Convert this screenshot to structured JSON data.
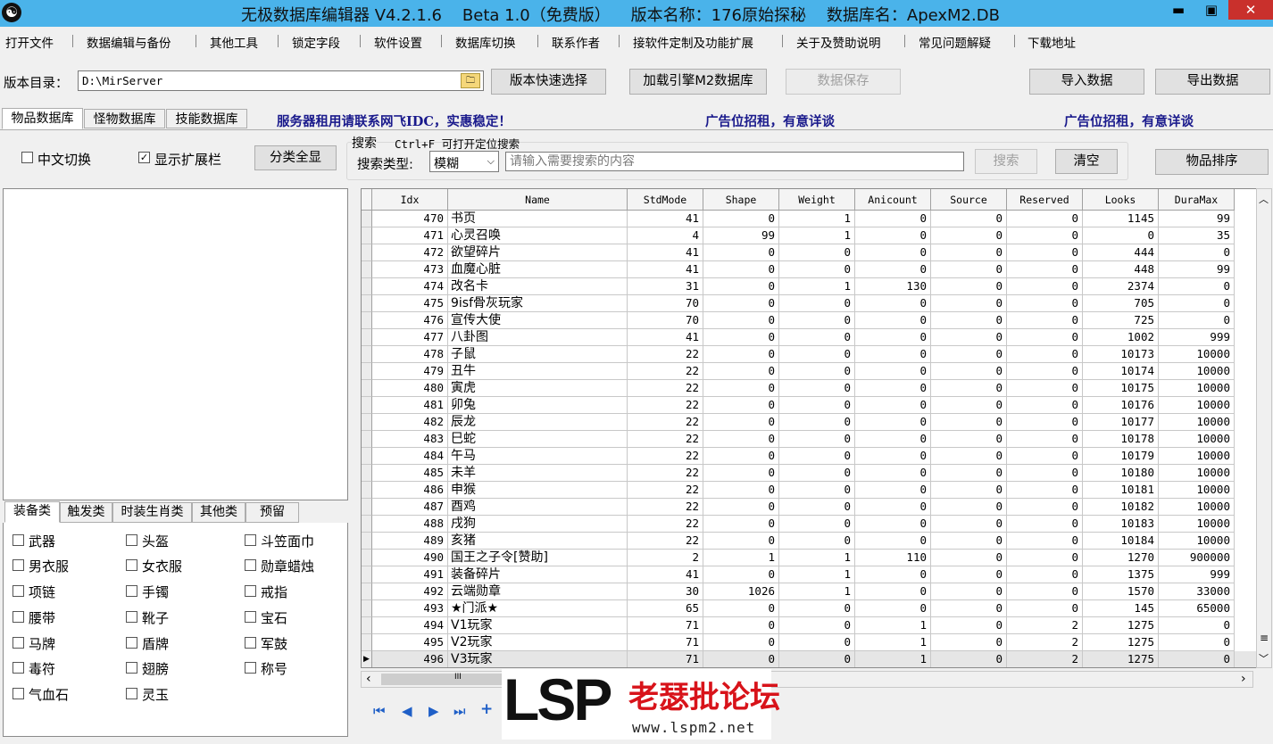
{
  "titlebar": {
    "title": "无极数据库编辑器 V4.2.1.6    Beta 1.0（免费版）    版本名称：176原始探秘    数据库名：ApexM2.DB",
    "app_icon": "yin-yang-icon",
    "min": "▬",
    "max": "▣",
    "close": "✕"
  },
  "menu": [
    "打开文件",
    "数据编辑与备份",
    "其他工具",
    "锁定字段",
    "软件设置",
    "数据库切换",
    "联系作者",
    "接软件定制及功能扩展",
    "关于及赞助说明",
    "常见问题解疑",
    "下载地址"
  ],
  "toolbar": {
    "dir_label": "版本目录：",
    "dir_value": "D:\\MirServer",
    "quick_select": "版本快速选择",
    "load_engine": "加载引擎M2数据库",
    "save": "数据保存",
    "import": "导入数据",
    "export": "导出数据"
  },
  "tabs": [
    "物品数据库",
    "怪物数据库",
    "技能数据库"
  ],
  "ads": [
    "服务器租用请联系网飞IDC，实惠稳定！",
    "广告位招租，有意详谈",
    "广告位招租，有意详谈"
  ],
  "options": {
    "chinese_switch": "中文切换",
    "show_ext": "显示扩展栏",
    "show_all": "分类全显",
    "check": "✓"
  },
  "search": {
    "title": "搜索",
    "hint": "Ctrl+F 可打开定位搜索",
    "type_label": "搜索类型:",
    "type_value": "模糊",
    "placeholder": "请输入需要搜索的内容",
    "search_btn": "搜索",
    "clear_btn": "清空",
    "sort_btn": "物品排序"
  },
  "cat_tabs": [
    "装备类",
    "触发类",
    "时装生肖类",
    "其他类",
    "预留"
  ],
  "categories": [
    "武器",
    "头盔",
    "斗笠面巾",
    "男衣服",
    "女衣服",
    "勋章蜡烛",
    "项链",
    "手镯",
    "戒指",
    "腰带",
    "靴子",
    "宝石",
    "马牌",
    "盾牌",
    "军鼓",
    "毒符",
    "翅膀",
    "称号",
    "气血石",
    "灵玉"
  ],
  "grid": {
    "columns": [
      "Idx",
      "Name",
      "StdMode",
      "Shape",
      "Weight",
      "Anicount",
      "Source",
      "Reserved",
      "Looks",
      "DuraMax"
    ],
    "current_marker": "▶",
    "rows": [
      [
        "470",
        "书页",
        "41",
        "0",
        "1",
        "0",
        "0",
        "0",
        "1145",
        "99"
      ],
      [
        "471",
        "心灵召唤",
        "4",
        "99",
        "1",
        "0",
        "0",
        "0",
        "0",
        "35"
      ],
      [
        "472",
        "欲望碎片",
        "41",
        "0",
        "0",
        "0",
        "0",
        "0",
        "444",
        "0"
      ],
      [
        "473",
        "血魔心脏",
        "41",
        "0",
        "0",
        "0",
        "0",
        "0",
        "448",
        "99"
      ],
      [
        "474",
        "改名卡",
        "31",
        "0",
        "1",
        "130",
        "0",
        "0",
        "2374",
        "0"
      ],
      [
        "475",
        "9isf骨灰玩家",
        "70",
        "0",
        "0",
        "0",
        "0",
        "0",
        "705",
        "0"
      ],
      [
        "476",
        "宣传大使",
        "70",
        "0",
        "0",
        "0",
        "0",
        "0",
        "725",
        "0"
      ],
      [
        "477",
        "八卦图",
        "41",
        "0",
        "0",
        "0",
        "0",
        "0",
        "1002",
        "999"
      ],
      [
        "478",
        "子鼠",
        "22",
        "0",
        "0",
        "0",
        "0",
        "0",
        "10173",
        "10000"
      ],
      [
        "479",
        "丑牛",
        "22",
        "0",
        "0",
        "0",
        "0",
        "0",
        "10174",
        "10000"
      ],
      [
        "480",
        "寅虎",
        "22",
        "0",
        "0",
        "0",
        "0",
        "0",
        "10175",
        "10000"
      ],
      [
        "481",
        "卯兔",
        "22",
        "0",
        "0",
        "0",
        "0",
        "0",
        "10176",
        "10000"
      ],
      [
        "482",
        "辰龙",
        "22",
        "0",
        "0",
        "0",
        "0",
        "0",
        "10177",
        "10000"
      ],
      [
        "483",
        "巳蛇",
        "22",
        "0",
        "0",
        "0",
        "0",
        "0",
        "10178",
        "10000"
      ],
      [
        "484",
        "午马",
        "22",
        "0",
        "0",
        "0",
        "0",
        "0",
        "10179",
        "10000"
      ],
      [
        "485",
        "未羊",
        "22",
        "0",
        "0",
        "0",
        "0",
        "0",
        "10180",
        "10000"
      ],
      [
        "486",
        "申猴",
        "22",
        "0",
        "0",
        "0",
        "0",
        "0",
        "10181",
        "10000"
      ],
      [
        "487",
        "酉鸡",
        "22",
        "0",
        "0",
        "0",
        "0",
        "0",
        "10182",
        "10000"
      ],
      [
        "488",
        "戌狗",
        "22",
        "0",
        "0",
        "0",
        "0",
        "0",
        "10183",
        "10000"
      ],
      [
        "489",
        "亥猪",
        "22",
        "0",
        "0",
        "0",
        "0",
        "0",
        "10184",
        "10000"
      ],
      [
        "490",
        "国王之子令[赞助]",
        "2",
        "1",
        "1",
        "110",
        "0",
        "0",
        "1270",
        "900000"
      ],
      [
        "491",
        "装备碎片",
        "41",
        "0",
        "1",
        "0",
        "0",
        "0",
        "1375",
        "999"
      ],
      [
        "492",
        "云端勋章",
        "30",
        "1026",
        "1",
        "0",
        "0",
        "0",
        "1570",
        "33000"
      ],
      [
        "493",
        "★门派★",
        "65",
        "0",
        "0",
        "0",
        "0",
        "0",
        "145",
        "65000"
      ],
      [
        "494",
        "V1玩家",
        "71",
        "0",
        "0",
        "1",
        "0",
        "2",
        "1275",
        "0"
      ],
      [
        "495",
        "V2玩家",
        "71",
        "0",
        "0",
        "1",
        "0",
        "2",
        "1275",
        "0"
      ],
      [
        "496",
        "V3玩家",
        "71",
        "0",
        "0",
        "1",
        "0",
        "2",
        "1275",
        "0"
      ]
    ]
  },
  "scroll": {
    "up": "︿",
    "down": "﹀",
    "left": "‹",
    "right": "›",
    "grip": "≡",
    "hgrip": "III"
  },
  "nav": [
    "⏮",
    "◀",
    "▶",
    "⏭",
    "+"
  ],
  "watermark": {
    "logo": "LSP",
    "name": "老瑟批论坛",
    "url": "www.lspm2.net"
  }
}
